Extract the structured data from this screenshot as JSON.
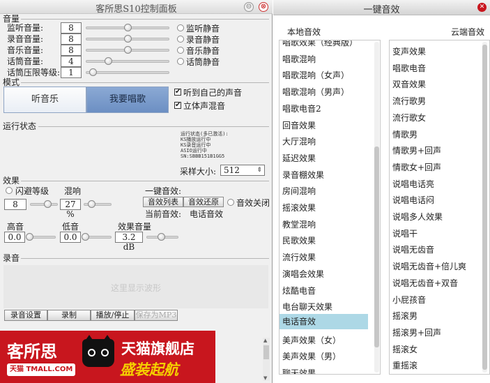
{
  "main_window": {
    "title": "客所思S10控制面板",
    "min_glyph": "⊝",
    "close_glyph": "⊗"
  },
  "volume": {
    "section": "音量",
    "rows": [
      {
        "label": "监听音量:",
        "value": "8",
        "mute": "监听静音",
        "level": 0.5
      },
      {
        "label": "录音音量:",
        "value": "8",
        "mute": "录音静音",
        "level": 0.5
      },
      {
        "label": "音乐音量:",
        "value": "8",
        "mute": "音乐静音",
        "level": 0.5
      },
      {
        "label": "话筒音量:",
        "value": "4",
        "mute": "话筒静音",
        "level": 0.27
      },
      {
        "label": "话筒压限等级:",
        "value": "1",
        "level": 0.08
      }
    ]
  },
  "mode": {
    "section": "模式",
    "listen_label": "听音乐",
    "sing_label": "我要唱歌",
    "hear_self_label": "听到自己的声音",
    "stereo_mix_label": "立体声混音",
    "check_glyph": "✔"
  },
  "status": {
    "section": "运行状态",
    "lines": [
      "运行状态(多已激活):",
      "KS播放运行中",
      "KS录音运行中",
      "ASIO运行中",
      "SN:SBBB151B1GG5"
    ],
    "sample_label": "采样大小:",
    "sample_value": "512",
    "sample_arrow": "⇕"
  },
  "effects": {
    "section": "效果",
    "flash_label": "闪避等级",
    "flash_value": "8",
    "flash_level": 0.62,
    "reverb_label": "混响",
    "reverb_value": "27 %",
    "reverb_level": 0.27,
    "one_key_label": "一键音效:",
    "list_btn": "音效列表",
    "restore_btn": "音效还原",
    "off_label": "音效关闭",
    "current_label": "当前音效:",
    "current_value": "电话音效",
    "treble_label": "高音",
    "treble_value": "0.0",
    "bass_label": "低音",
    "bass_value": "0.0",
    "fx_volume_label": "效果音量",
    "fx_volume_value": "3.2 dB",
    "fx_volume_level": 0.45
  },
  "record": {
    "section": "录音",
    "wave_placeholder": "这里显示波形",
    "settings_btn": "录音设置",
    "record_btn": "录制",
    "play_btn": "播放/停止",
    "save_btn": "保存为MP3"
  },
  "banner": {
    "brand": "客所思",
    "store": "天猫旗舰店",
    "slogan": "盛装起航",
    "tmall_badge": "天猫 TMALL.COM"
  },
  "effects_window": {
    "title": "一键音效",
    "close_glyph": "✕",
    "local_header": "本地音效",
    "cloud_header": "云端音效",
    "local_items": [
      "唱歌效果（经典版）",
      "唱歌混响",
      "唱歌混响（女声）",
      "唱歌混响（男声）",
      "唱歌电音2",
      "回音效果",
      "大厅混响",
      "延迟效果",
      "录音棚效果",
      "房间混响",
      "摇滚效果",
      "教堂混响",
      "民歌效果",
      "流行效果",
      "演唱会效果",
      "炫酷电音",
      "电台聊天效果",
      "电话音效",
      "美声效果（女）",
      "美声效果（男）",
      "聊天效果"
    ],
    "local_selected": "电话音效",
    "cloud_items": [
      "变声效果",
      "唱歌电音",
      "双音效果",
      "流行歌男",
      "流行歌女",
      "情歌男",
      "情歌男+回声",
      "情歌女+回声",
      "说唱电话亮",
      "说唱电话闷",
      "说唱多人效果",
      "说唱干",
      "说唱无齿音",
      "说唱无齿音+倍儿爽",
      "说唱无齿音+双音",
      "小屁孩音",
      "摇滚男",
      "摇滚男+回声",
      "摇滚女",
      "重摇滚"
    ]
  }
}
